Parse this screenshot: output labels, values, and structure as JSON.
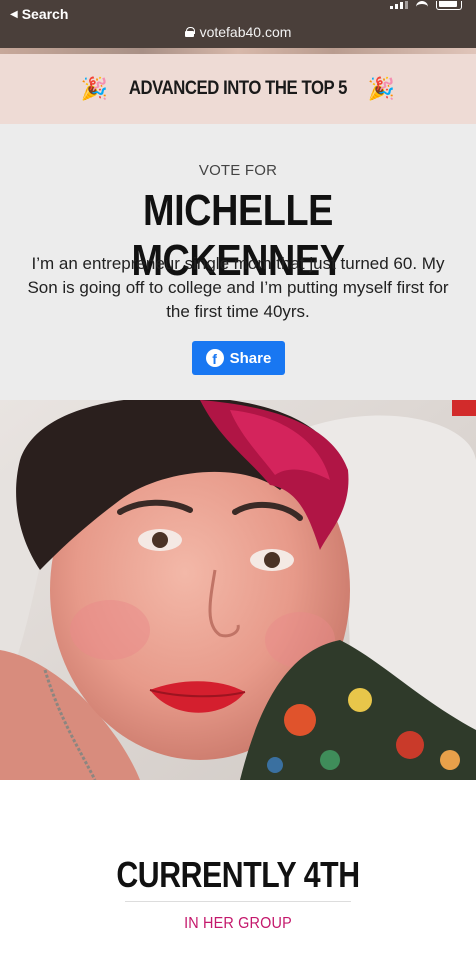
{
  "status_bar": {
    "back_label": "Search",
    "url": "votefab40.com"
  },
  "banner": {
    "text": "ADVANCED INTO THE TOP 5",
    "icon_left": "party-popper-icon",
    "icon_right": "party-popper-icon"
  },
  "vote": {
    "label": "VOTE FOR",
    "name": "MICHELLE MCKENNEY",
    "bio": "I’m an entrepreneur single mom that just turned 60. My Son is going off to college and I’m putting myself first for the first time 40yrs.",
    "share_label": "Share",
    "share_icon": "facebook-icon"
  },
  "rank": {
    "title": "CURRENTLY 4TH",
    "subtitle": "IN HER GROUP"
  },
  "colors": {
    "status_bar": "#4a3f3a",
    "banner_bg": "#eedbd5",
    "vote_bg": "#ececec",
    "facebook_blue": "#1877f2",
    "accent_pink": "#c4186c"
  }
}
